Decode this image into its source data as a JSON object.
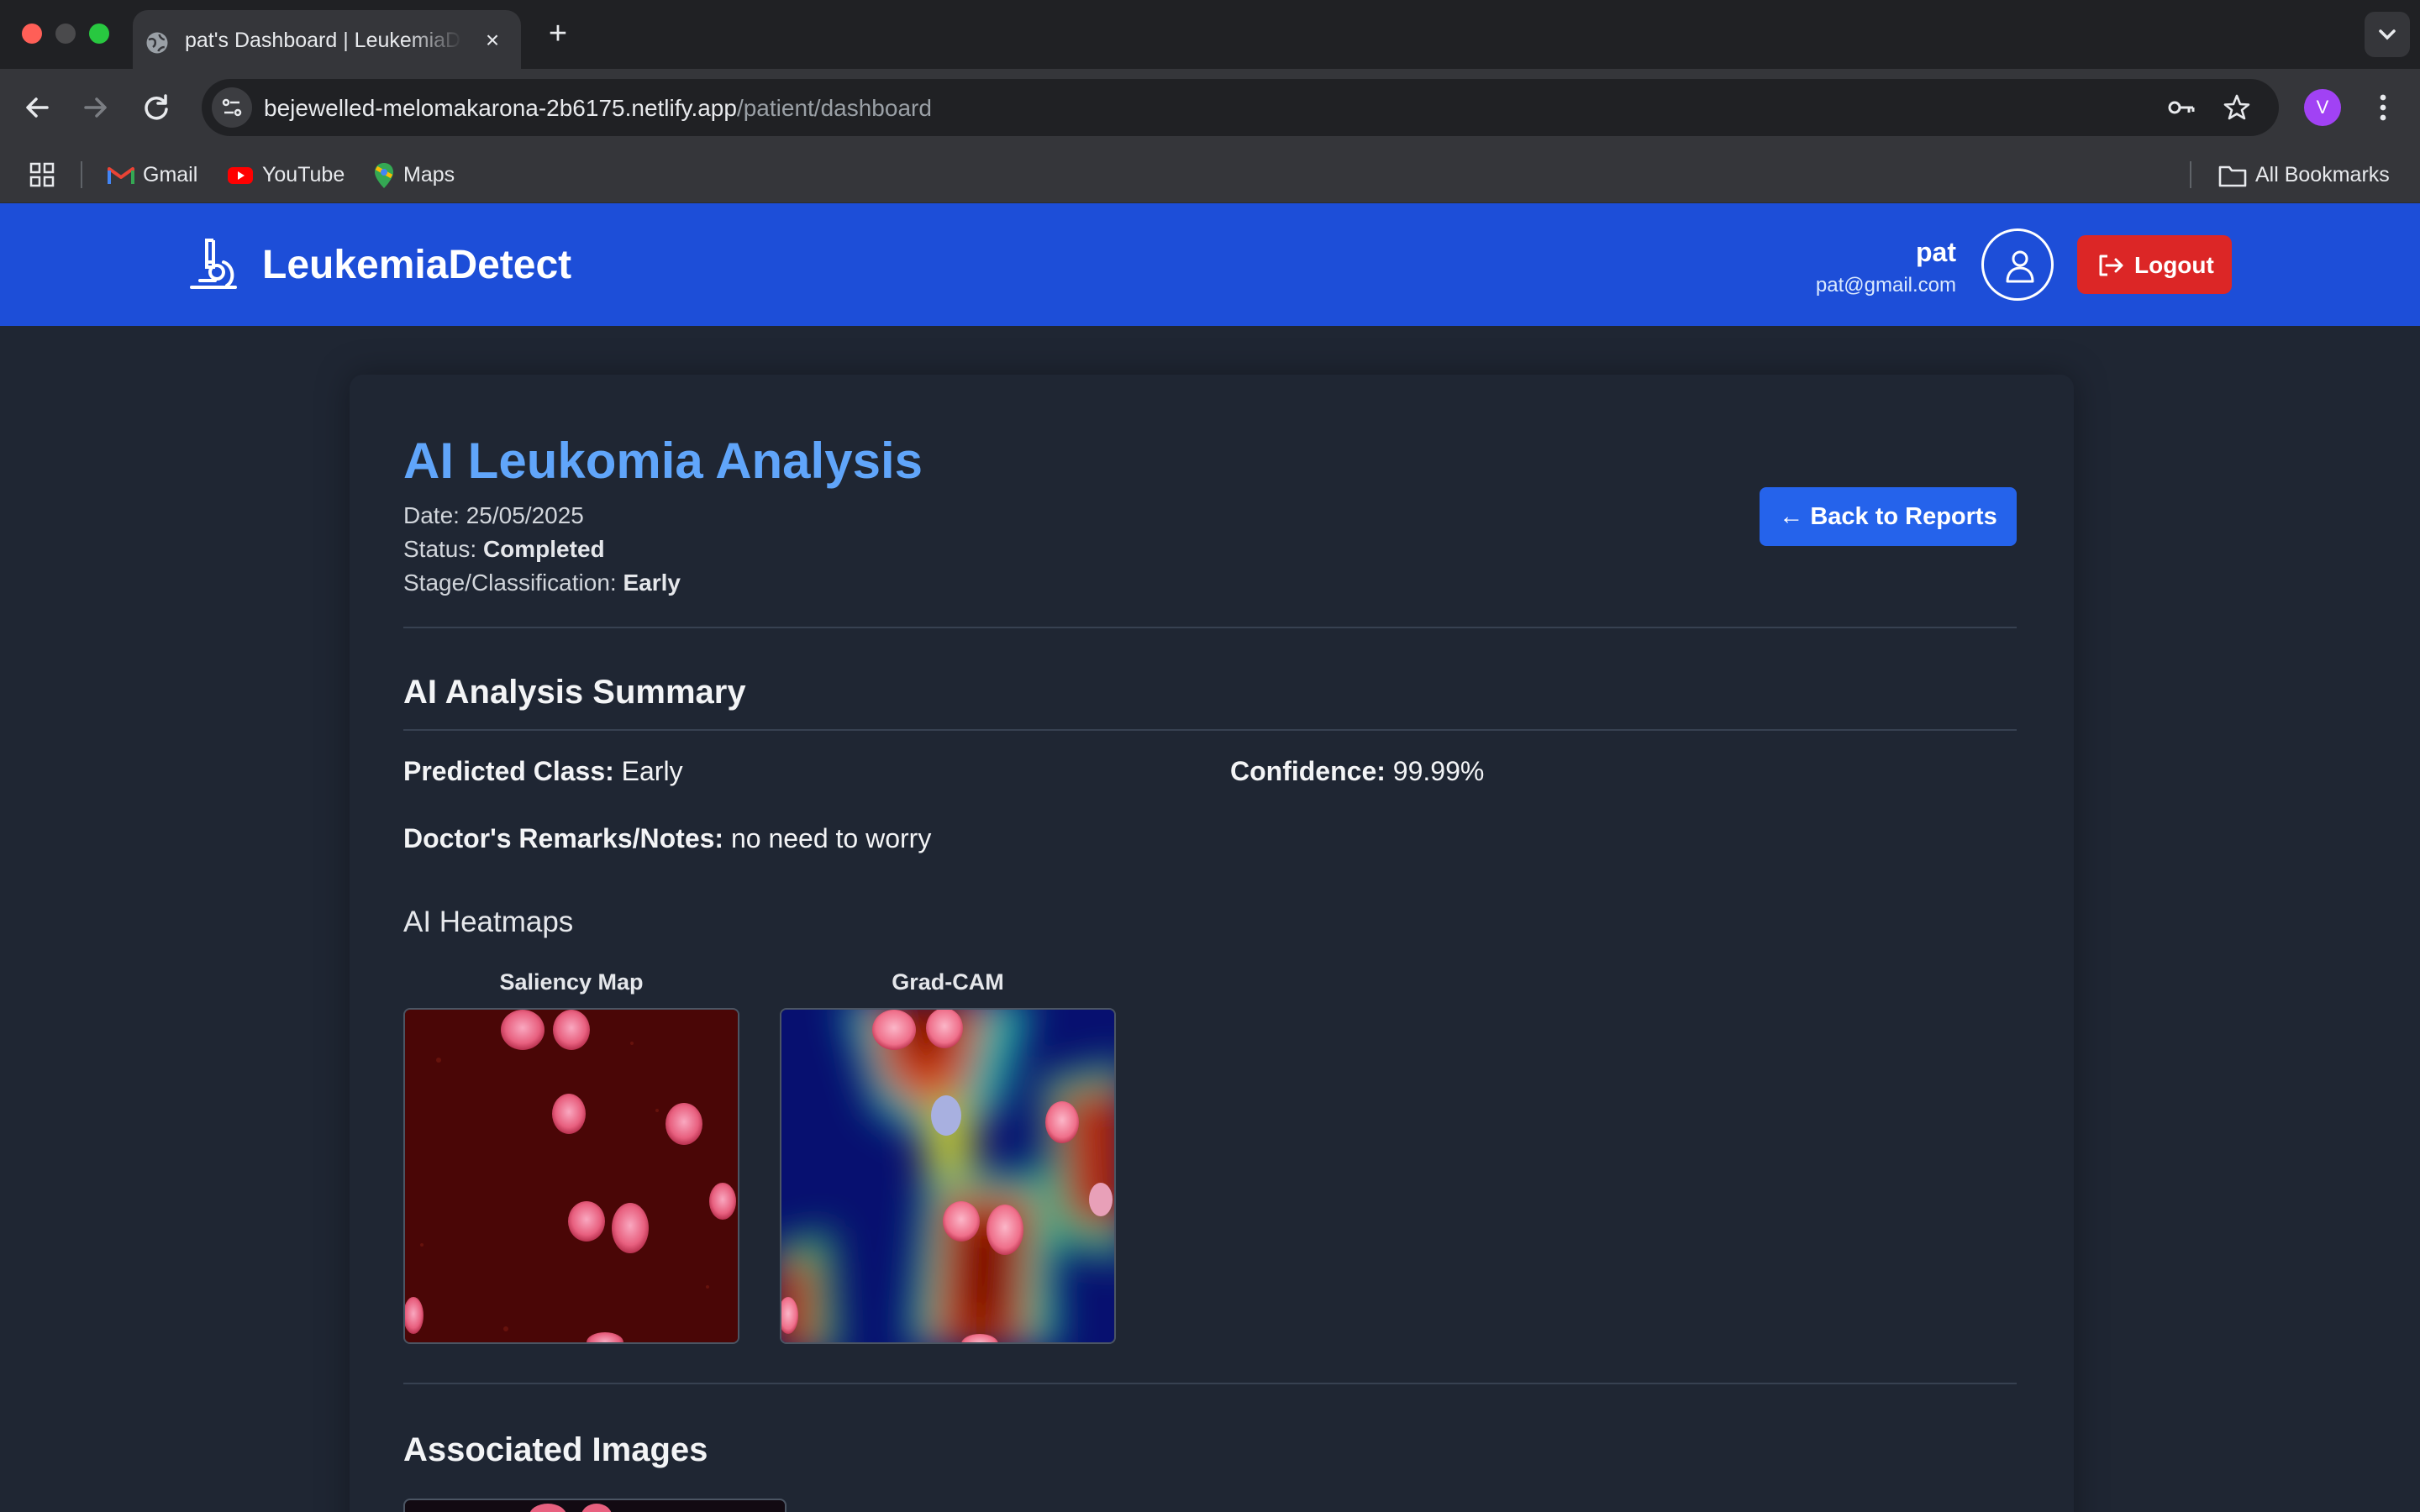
{
  "browser": {
    "tab_title": "pat's Dashboard | LeukemiaDetect",
    "new_tab_symbol": "+",
    "close_symbol": "×",
    "url_host": "bejewelled-melomakarona-2b6175.netlify.app",
    "url_path": "/patient/dashboard",
    "profile_initial": "V",
    "bookmarks": [
      {
        "label": "Gmail",
        "icon": "gmail-icon"
      },
      {
        "label": "YouTube",
        "icon": "youtube-icon"
      },
      {
        "label": "Maps",
        "icon": "maps-icon"
      }
    ],
    "all_bookmarks": "All Bookmarks"
  },
  "header": {
    "brand": "LeukemiaDetect",
    "brand_icon": "microscope-icon",
    "user_name": "pat",
    "user_email": "pat@gmail.com",
    "logout_label": "Logout",
    "color": "#1d4ed8"
  },
  "report": {
    "title": "AI Leukomia Analysis",
    "date_label": "Date:",
    "date": "25/05/2025",
    "status_label": "Status:",
    "status": "Completed",
    "stage_label": "Stage/Classification:",
    "stage": "Early",
    "back_label": "← Back to Reports"
  },
  "summary": {
    "heading": "AI Analysis Summary",
    "predicted_label": "Predicted Class:",
    "predicted_value": "Early",
    "confidence_label": "Confidence:",
    "confidence_value": "99.99%",
    "remarks_label": "Doctor's Remarks/Notes:",
    "remarks_value": "no need to worry"
  },
  "heatmaps": {
    "heading": "AI Heatmaps",
    "items": [
      {
        "caption": "Saliency Map"
      },
      {
        "caption": "Grad-CAM"
      }
    ]
  },
  "associated": {
    "heading": "Associated Images"
  },
  "colors": {
    "accent": "#60a5fa",
    "button_blue": "#2563eb",
    "logout_red": "#dc2626",
    "background": "#1f2633"
  }
}
